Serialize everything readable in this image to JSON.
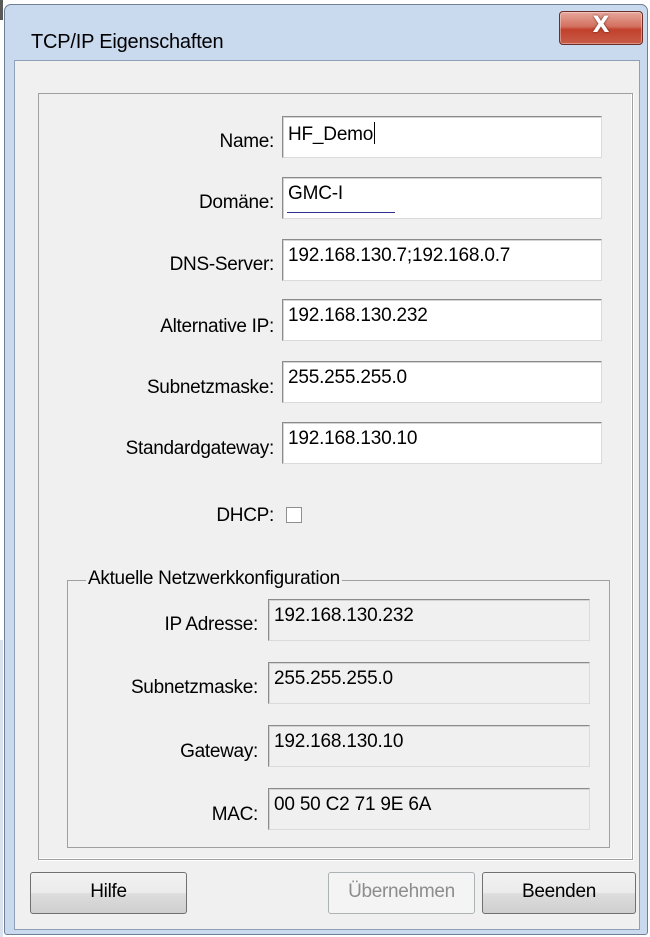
{
  "window": {
    "title": "TCP/IP Eigenschaften",
    "close_glyph": "X"
  },
  "form": {
    "name": {
      "label": "Name:",
      "value": "HF_Demo"
    },
    "domain": {
      "label": "Domäne:",
      "value": "GMC-I"
    },
    "dns": {
      "label": "DNS-Server:",
      "value": "192.168.130.7;192.168.0.7"
    },
    "alt_ip": {
      "label": "Alternative IP:",
      "value": "192.168.130.232"
    },
    "subnet": {
      "label": "Subnetzmaske:",
      "value": "255.255.255.0"
    },
    "gateway": {
      "label": "Standardgateway:",
      "value": "192.168.130.10"
    },
    "dhcp": {
      "label": "DHCP:",
      "checked": false
    }
  },
  "current_config": {
    "title": "Aktuelle Netzwerkkonfiguration",
    "ip": {
      "label": "IP Adresse:",
      "value": "192.168.130.232"
    },
    "subnet": {
      "label": "Subnetzmaske:",
      "value": "255.255.255.0"
    },
    "gateway": {
      "label": "Gateway:",
      "value": "192.168.130.10"
    },
    "mac": {
      "label": "MAC:",
      "value": "00 50 C2 71 9E 6A"
    }
  },
  "buttons": {
    "help": "Hilfe",
    "apply": "Übernehmen",
    "close": "Beenden"
  },
  "icons": {
    "close": "close-icon",
    "checkbox": "checkbox-unchecked"
  }
}
